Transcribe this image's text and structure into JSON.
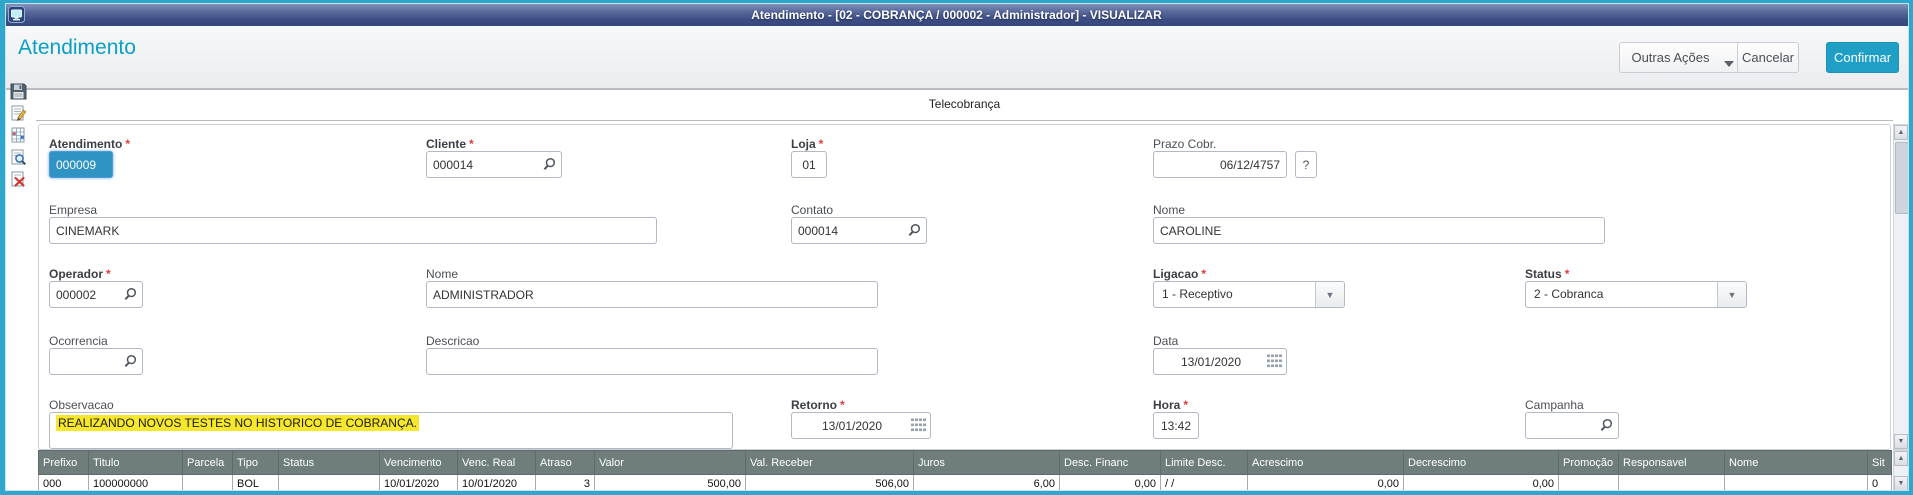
{
  "window": {
    "title": "Atendimento - [02 - COBRANÇA / 000002 - Administrador] - VISUALIZAR"
  },
  "header": {
    "title": "Atendimento",
    "outras_acoes": "Outras Ações",
    "cancelar": "Cancelar",
    "confirmar": "Confirmar"
  },
  "tabs": {
    "telecobranca": "Telecobrança"
  },
  "ui": {
    "required_marker": "*",
    "help_label": "?",
    "scroll_up": "▲",
    "scroll_down": "▼",
    "dropdown_arrow": "▼"
  },
  "sidebar": {
    "icons": [
      "save-icon",
      "edit-note-icon",
      "spreadsheet-icon",
      "search-document-icon",
      "delete-document-icon"
    ]
  },
  "form": {
    "atendimento": {
      "label": "Atendimento",
      "value": "000009"
    },
    "cliente": {
      "label": "Cliente",
      "value": "000014"
    },
    "loja": {
      "label": "Loja",
      "value": "01"
    },
    "prazo_cobr": {
      "label": "Prazo Cobr.",
      "value": "06/12/4757"
    },
    "empresa": {
      "label": "Empresa",
      "value": "CINEMARK"
    },
    "contato": {
      "label": "Contato",
      "value": "000014"
    },
    "nome_contato": {
      "label": "Nome",
      "value": "CAROLINE"
    },
    "operador": {
      "label": "Operador",
      "value": "000002"
    },
    "nome_operador": {
      "label": "Nome",
      "value": "ADMINISTRADOR"
    },
    "ligacao": {
      "label": "Ligacao",
      "value": "1 - Receptivo"
    },
    "status": {
      "label": "Status",
      "value": "2 - Cobranca"
    },
    "ocorrencia": {
      "label": "Ocorrencia",
      "value": ""
    },
    "descricao": {
      "label": "Descricao",
      "value": ""
    },
    "data": {
      "label": "Data",
      "value": "13/01/2020"
    },
    "observacao": {
      "label": "Observacao",
      "value": "REALIZANDO NOVOS TESTES NO HISTORICO DE COBRANÇA."
    },
    "retorno": {
      "label": "Retorno",
      "value": "13/01/2020"
    },
    "hora": {
      "label": "Hora",
      "value": "13:42"
    },
    "campanha": {
      "label": "Campanha",
      "value": ""
    }
  },
  "grid": {
    "columns": [
      "Prefixo",
      "Titulo",
      "Parcela",
      "Tipo",
      "Status",
      "Vencimento",
      "Venc. Real",
      "Atraso",
      "Valor",
      "Val. Receber",
      "Juros",
      "Desc. Financ",
      "Limite Desc.",
      "Acrescimo",
      "Decrescimo",
      "Promoção",
      "Responsavel",
      "Nome",
      "Sit"
    ],
    "row": [
      "000",
      "100000000",
      "",
      "BOL",
      "",
      "10/01/2020",
      "10/01/2020",
      "3",
      "500,00",
      "506,00",
      "6,00",
      "0,00",
      "/ /",
      "0,00",
      "0,00",
      "",
      "",
      "",
      "0"
    ]
  },
  "colors": {
    "frame": "#2fa6cb",
    "titlebar": "#44548a",
    "page_title": "#0b9fc6",
    "accent_button": "#1f9fc6",
    "grid_header_bg": "#6f7d7d",
    "selection_blue": "#2f93c4",
    "highlight_yellow": "#f6e72b",
    "required_red": "#e03b3b"
  }
}
